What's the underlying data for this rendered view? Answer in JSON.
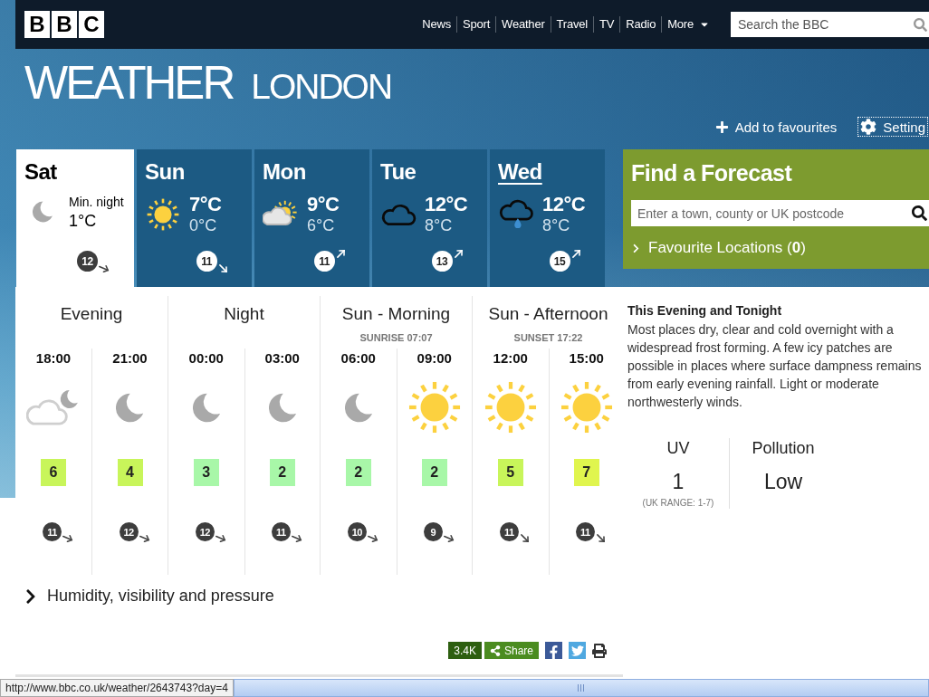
{
  "nav": {
    "logo": [
      "B",
      "B",
      "C"
    ],
    "links": [
      {
        "label": "News",
        "kind": "link"
      },
      {
        "label": "Sport",
        "kind": "link"
      },
      {
        "label": "Weather",
        "kind": "link"
      },
      {
        "label": "Travel",
        "kind": "link"
      },
      {
        "label": "TV",
        "kind": "link"
      },
      {
        "label": "Radio",
        "kind": "link"
      },
      {
        "label": "More",
        "kind": "menu"
      }
    ],
    "search": {
      "placeholder": "Search the BBC"
    }
  },
  "masthead": {
    "title": "WEATHER",
    "location": "LONDON",
    "actions": [
      {
        "kind": "favourite",
        "label": "Add to favourites",
        "focused": false
      },
      {
        "kind": "settings",
        "label": "Setting",
        "focused": true
      }
    ]
  },
  "days": [
    {
      "name": "Sat",
      "selected": true,
      "hovered": false,
      "kind": "moon",
      "label": "Min. night",
      "min": "1°C",
      "wind": {
        "speed": "12",
        "kind": "ese"
      }
    },
    {
      "name": "Sun",
      "selected": false,
      "hovered": false,
      "kind": "sun",
      "max": "7°C",
      "min": "0°C",
      "wind": {
        "speed": "11",
        "kind": "se"
      }
    },
    {
      "name": "Mon",
      "selected": false,
      "hovered": false,
      "kind": "sun-cloud",
      "max": "9°C",
      "min": "6°C",
      "wind": {
        "speed": "11",
        "kind": "ne"
      }
    },
    {
      "name": "Tue",
      "selected": false,
      "hovered": false,
      "kind": "cloud",
      "max": "12°C",
      "min": "8°C",
      "wind": {
        "speed": "13",
        "kind": "ne"
      }
    },
    {
      "name": "Wed",
      "selected": false,
      "hovered": true,
      "kind": "rain",
      "max": "12°C",
      "min": "8°C",
      "wind": {
        "speed": "15",
        "kind": "ne"
      }
    }
  ],
  "find_forecast": {
    "title": "Find a Forecast",
    "search": {
      "placeholder": "Enter a town, county or UK postcode"
    },
    "favourites": "Favourite Locations (**0**)"
  },
  "periods": [
    {
      "name": "Evening",
      "hours": [
        {
          "time": "18:00",
          "kind": "cloud-moon",
          "temp": "6",
          "color": "#c8f55a",
          "wind": {
            "speed": "11",
            "kind": "ese"
          }
        },
        {
          "time": "21:00",
          "kind": "moon",
          "temp": "4",
          "color": "#c8f55a",
          "wind": {
            "speed": "12",
            "kind": "ese"
          }
        }
      ]
    },
    {
      "name": "Night",
      "hours": [
        {
          "time": "00:00",
          "kind": "moon",
          "temp": "3",
          "color": "#a8f7a8",
          "wind": {
            "speed": "12",
            "kind": "ese"
          }
        },
        {
          "time": "03:00",
          "kind": "moon",
          "temp": "2",
          "color": "#a8f7a8",
          "wind": {
            "speed": "11",
            "kind": "ese"
          }
        }
      ]
    },
    {
      "name": "Sun - Morning",
      "note": "SUNRISE 07:07",
      "hours": [
        {
          "time": "06:00",
          "kind": "moon",
          "temp": "2",
          "color": "#a8f7a8",
          "wind": {
            "speed": "10",
            "kind": "ese"
          }
        },
        {
          "time": "09:00",
          "kind": "sun",
          "temp": "2",
          "color": "#a8f7a8",
          "wind": {
            "speed": "9",
            "kind": "ese"
          }
        }
      ]
    },
    {
      "name": "Sun - Afternoon",
      "note": "SUNSET 17:22",
      "hours": [
        {
          "time": "12:00",
          "kind": "sun",
          "temp": "5",
          "color": "#c8f55a",
          "wind": {
            "speed": "11",
            "kind": "se"
          }
        },
        {
          "time": "15:00",
          "kind": "sun",
          "temp": "7",
          "color": "#e0f54e",
          "wind": {
            "speed": "11",
            "kind": "se"
          }
        }
      ]
    }
  ],
  "summary": {
    "title": "This Evening and Tonight",
    "text": "Most places dry, clear and cold overnight with a widespread frost forming. A few icy patches are possible in places where surface dampness remains from early evening rainfall. Light or moderate northwesterly winds."
  },
  "uv": {
    "label": "UV",
    "value": "1",
    "range": "(UK RANGE: 1-7)"
  },
  "pollution": {
    "label": "Pollution",
    "value": "Low"
  },
  "details_toggle": {
    "label": "Humidity, visibility and pressure",
    "expanded": false
  },
  "share": {
    "count": "3.4K",
    "label": "Share"
  },
  "status_bar": {
    "url": "http://www.bbc.co.uk/weather/2643743?day=4"
  }
}
